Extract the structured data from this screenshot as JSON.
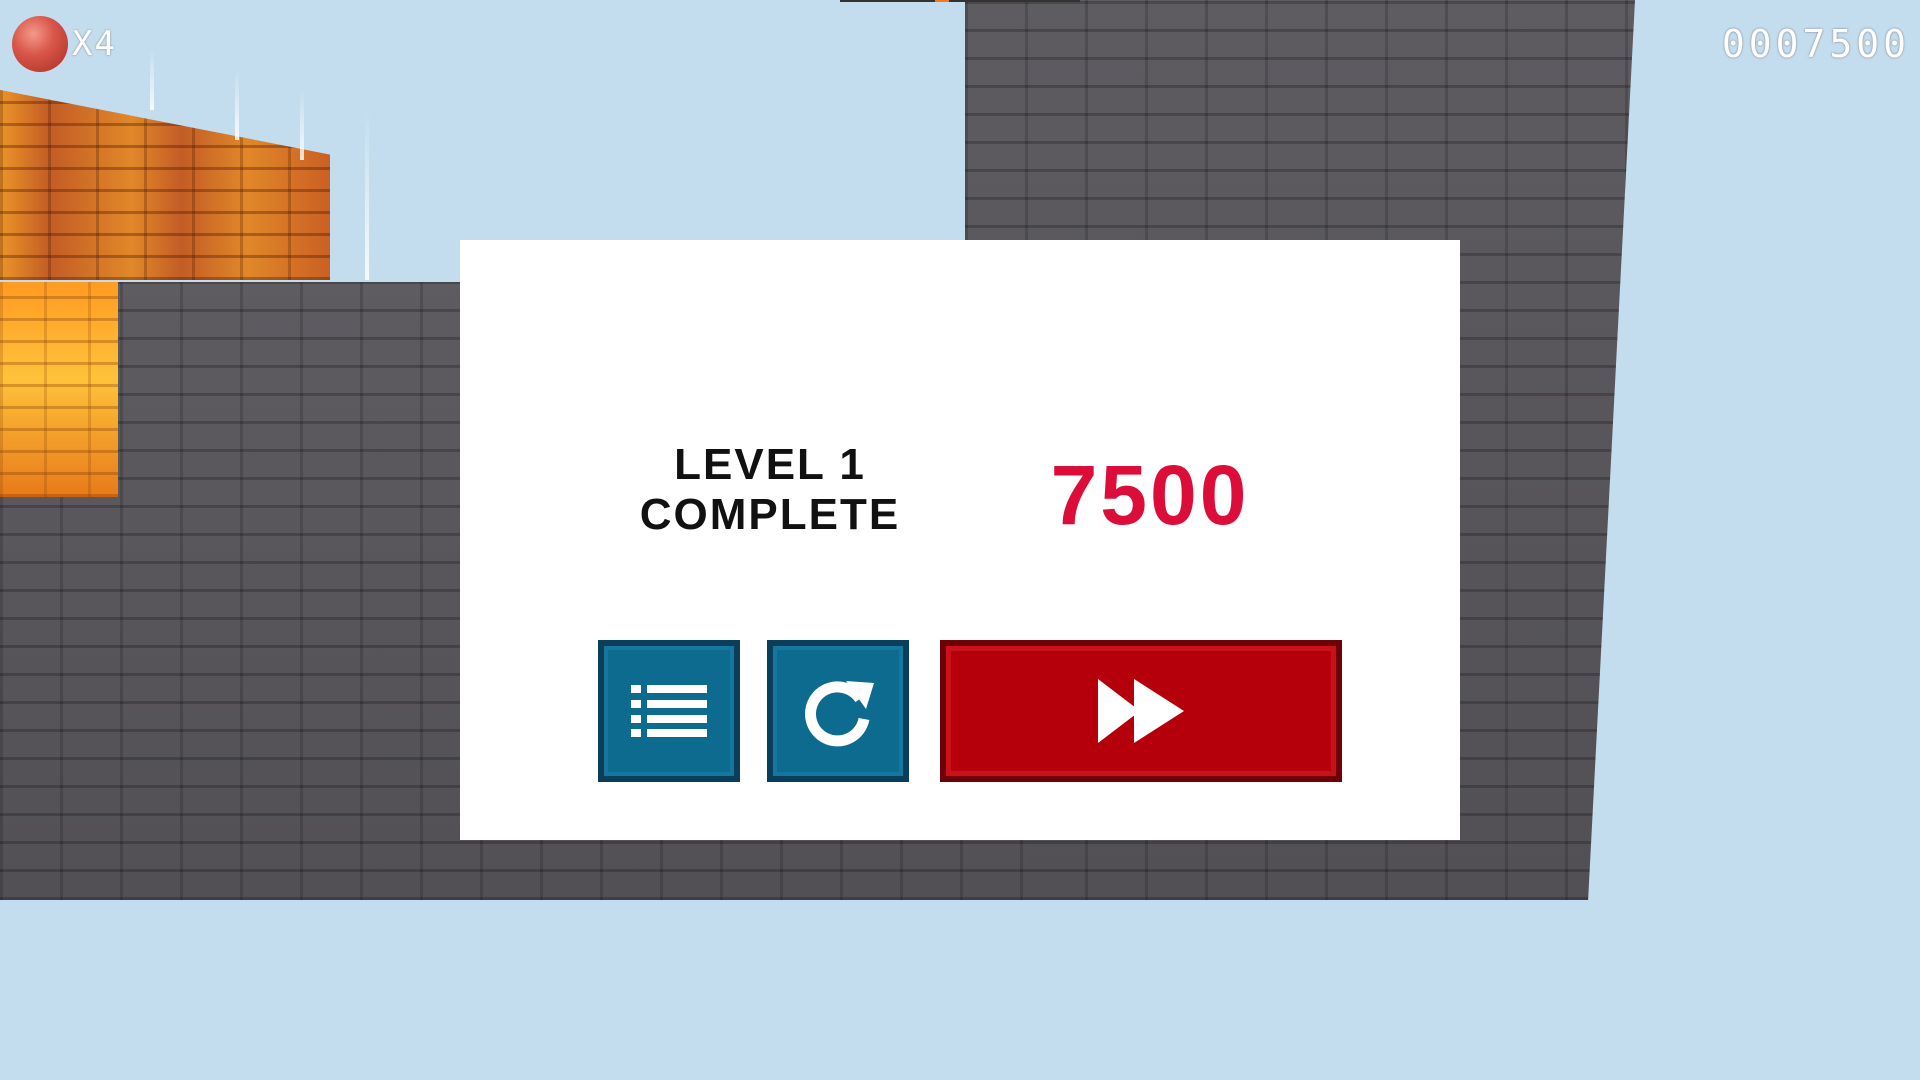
{
  "hud": {
    "lives": "X4",
    "score": "0007500"
  },
  "dialog": {
    "title_line1": "LEVEL 1",
    "title_line2": "COMPLETE",
    "score": "7500",
    "buttons": {
      "menu": "list-icon",
      "retry": "refresh-icon",
      "next": "fast-forward-icon"
    }
  },
  "colors": {
    "sky": "#c3ddef",
    "wall": "#57555a",
    "score_red": "#dd0d3a",
    "button_blue": "#0d6b8f",
    "button_red": "#b5000c"
  }
}
